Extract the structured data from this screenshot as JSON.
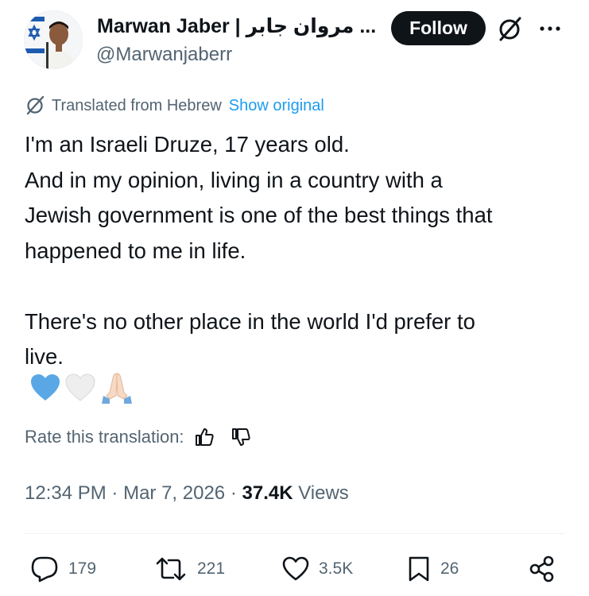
{
  "author": {
    "display_name": "Marwan Jaber | مروان جابر ...",
    "handle": "@Marwanjaberr"
  },
  "follow_label": "Follow",
  "translation": {
    "notice": "Translated from Hebrew",
    "show_original": "Show original"
  },
  "tweet": {
    "lines": [
      "I'm an Israeli Druze, 17 years old.",
      "And in my opinion, living in a country with a",
      "Jewish government is one of the best things that",
      "happened to me in life.",
      "There's no other place in the world I'd prefer to",
      "live."
    ],
    "emojis": [
      "blue-heart",
      "white-heart",
      "folded-hands"
    ]
  },
  "rate": {
    "label": "Rate this translation:"
  },
  "meta": {
    "time": "12:34 PM",
    "date": "Mar 7, 2026",
    "views_count": "37.4K",
    "views_label": "Views"
  },
  "actions": {
    "replies": "179",
    "reposts": "221",
    "likes": "3.5K",
    "bookmarks": "26"
  },
  "icons": [
    "grok-icon",
    "more-icon",
    "translate-icon",
    "thumbs-up-icon",
    "thumbs-down-icon",
    "reply-icon",
    "repost-icon",
    "like-icon",
    "bookmark-icon",
    "share-icon"
  ],
  "colors": {
    "text": "#0f1419",
    "secondary": "#536471",
    "link": "#1d9bf0",
    "follow_bg": "#0f1419"
  }
}
